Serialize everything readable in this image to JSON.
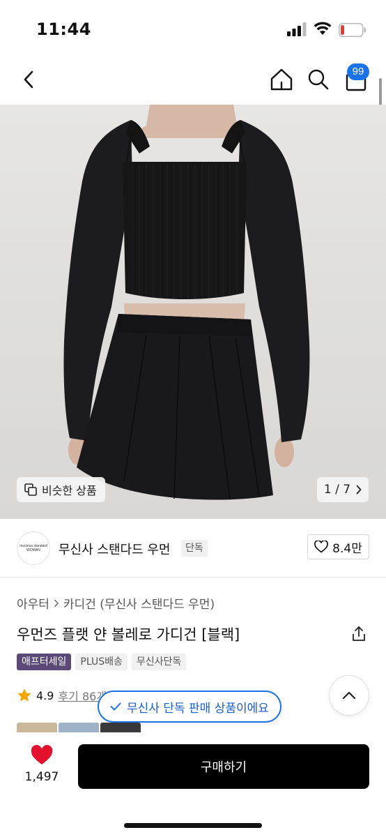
{
  "status_bar": {
    "time": "11:44"
  },
  "nav": {
    "back_icon": "chevron-left-icon",
    "home_icon": "home-icon",
    "search_icon": "search-icon",
    "cart_icon": "shopping-bag-icon",
    "cart_badge": "99",
    "badge_color": "#1a73e8"
  },
  "gallery": {
    "similar_label": "비슷한 상품",
    "pager": "1 / 7"
  },
  "brand": {
    "logo_lines": [
      "musinsa standard",
      "WOMAN"
    ],
    "name": "무신사 스탠다드 우먼",
    "tag": "단독",
    "like_count": "8.4만"
  },
  "product": {
    "breadcrumb": [
      "아우터",
      "카디건 (무신사 스탠다드 우먼)"
    ],
    "title": "우먼즈 플랫 얀 볼레로 가디건 [블랙]",
    "chips": [
      {
        "label": "애프터세일",
        "color": "#5b4a78"
      },
      {
        "label": "PLUS배송"
      },
      {
        "label": "무신사단독"
      }
    ],
    "rating": "4.9",
    "review_label": "후기 86개"
  },
  "toast": {
    "text": "무신사 단독 판매 상품이에요",
    "color": "#1a73e8"
  },
  "bottom_bar": {
    "like_count": "1,497",
    "heart_color": "#e4112e",
    "buy_label": "구매하기"
  }
}
